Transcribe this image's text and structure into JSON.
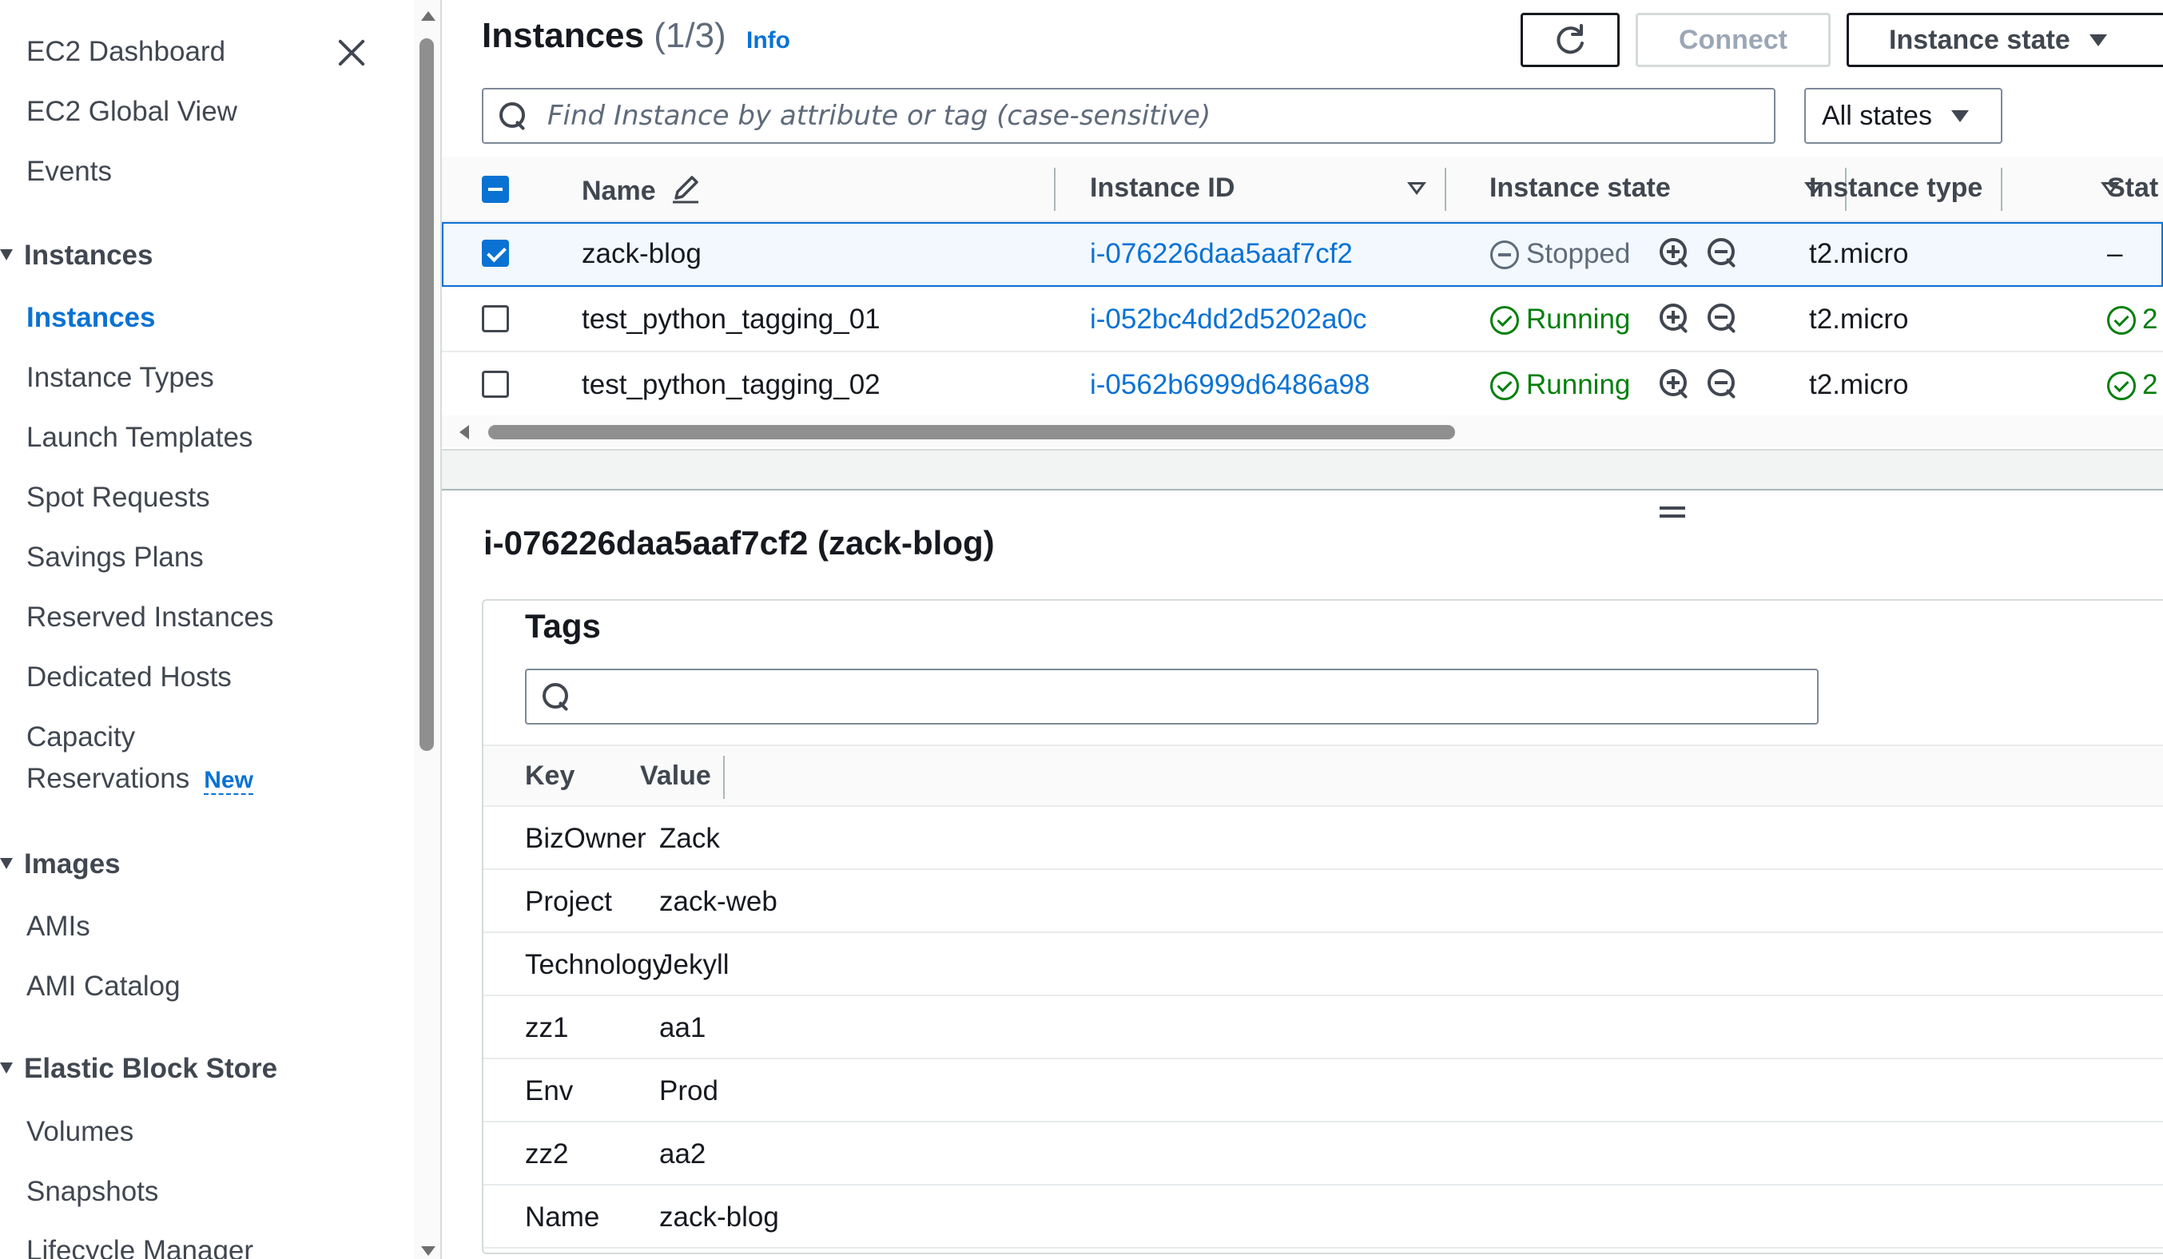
{
  "sidebar": {
    "top_items": [
      {
        "label": "EC2 Dashboard"
      },
      {
        "label": "EC2 Global View"
      },
      {
        "label": "Events"
      }
    ],
    "sections": [
      {
        "title": "Instances",
        "items": [
          {
            "label": "Instances",
            "active": true
          },
          {
            "label": "Instance Types"
          },
          {
            "label": "Launch Templates"
          },
          {
            "label": "Spot Requests"
          },
          {
            "label": "Savings Plans"
          },
          {
            "label": "Reserved Instances"
          },
          {
            "label": "Dedicated Hosts"
          },
          {
            "label": "Capacity"
          },
          {
            "label": "Reservations",
            "badge": "New"
          }
        ]
      },
      {
        "title": "Images",
        "items": [
          {
            "label": "AMIs"
          },
          {
            "label": "AMI Catalog"
          }
        ]
      },
      {
        "title": "Elastic Block Store",
        "items": [
          {
            "label": "Volumes"
          },
          {
            "label": "Snapshots"
          },
          {
            "label": "Lifecycle Manager"
          }
        ]
      }
    ]
  },
  "header": {
    "title": "Instances",
    "count": "(1/3)",
    "info": "Info",
    "connect_label": "Connect",
    "instance_state_label": "Instance state"
  },
  "search": {
    "placeholder": "Find Instance by attribute or tag (case-sensitive)",
    "states_filter": "All states"
  },
  "table": {
    "columns": [
      "Name",
      "Instance ID",
      "Instance state",
      "Instance type",
      "Stat"
    ],
    "rows": [
      {
        "name": "zack-blog",
        "id": "i-076226daa5aaf7cf2",
        "state": "Stopped",
        "type": "t2.micro",
        "status": "–",
        "selected": true
      },
      {
        "name": "test_python_tagging_01",
        "id": "i-052bc4dd2d5202a0c",
        "state": "Running",
        "type": "t2.micro",
        "status": "2",
        "selected": false
      },
      {
        "name": "test_python_tagging_02",
        "id": "i-0562b6999d6486a98",
        "state": "Running",
        "type": "t2.micro",
        "status": "2",
        "selected": false
      }
    ]
  },
  "detail": {
    "title": "i-076226daa5aaf7cf2 (zack-blog)",
    "tags_heading": "Tags",
    "tag_search_placeholder": "",
    "columns": [
      "Key",
      "Value"
    ],
    "tags": [
      {
        "key": "BizOwner",
        "value": "Zack"
      },
      {
        "key": "Project",
        "value": "zack-web"
      },
      {
        "key": "Technology",
        "value": "Jekyll"
      },
      {
        "key": "zz1",
        "value": "aa1"
      },
      {
        "key": "Env",
        "value": "Prod"
      },
      {
        "key": "zz2",
        "value": "aa2"
      },
      {
        "key": "Name",
        "value": "zack-blog"
      }
    ]
  },
  "colors": {
    "link": "#0972d3",
    "running": "#037f0c",
    "stopped": "#5f6b7a",
    "selected_row_bg": "#f2f8fd"
  }
}
